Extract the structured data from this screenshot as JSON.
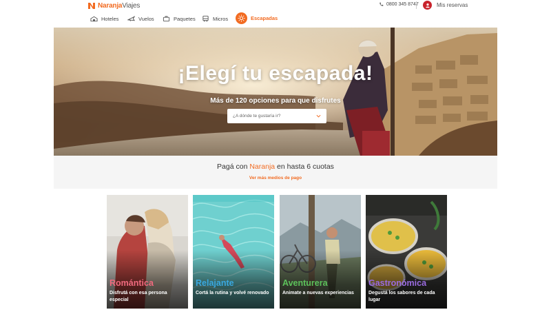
{
  "header": {
    "logo_brand": "Naranja",
    "logo_suffix": "Viajes",
    "phone": "0800 345 8747",
    "my_reservations": "Mis reservas"
  },
  "nav": {
    "items": [
      {
        "label": "Hoteles",
        "icon": "hotel-icon"
      },
      {
        "label": "Vuelos",
        "icon": "plane-icon"
      },
      {
        "label": "Paquetes",
        "icon": "suitcase-icon"
      },
      {
        "label": "Micros",
        "icon": "bus-icon"
      },
      {
        "label": "Escapadas",
        "icon": "sun-icon",
        "active": true
      }
    ]
  },
  "hero": {
    "title": "¡Elegí tu escapada!",
    "subtitle": "Más de 120 opciones para que disfrutes",
    "select_placeholder": "¿A dónde te gustaría ir?"
  },
  "payment": {
    "title_before": "Pagá con ",
    "title_brand": "Naranja",
    "title_after": " en hasta 6 cuotas",
    "link": "Ver más medios de pago"
  },
  "cards": [
    {
      "title": "Romántica",
      "desc": "Disfrutá con esa persona especial",
      "color": "#f06a7e"
    },
    {
      "title": "Relajante",
      "desc": "Cortá la rutina y volvé renovado",
      "color": "#3aa8e0"
    },
    {
      "title": "Aventurera",
      "desc": "Animate a nuevas experiencias",
      "color": "#5cc15a"
    },
    {
      "title": "Gastronómica",
      "desc": "Degustá los sabores de cada lugar",
      "color": "#9a6be0"
    }
  ],
  "colors": {
    "brand_orange": "#f26b21",
    "reservations_red": "#c8232c"
  }
}
